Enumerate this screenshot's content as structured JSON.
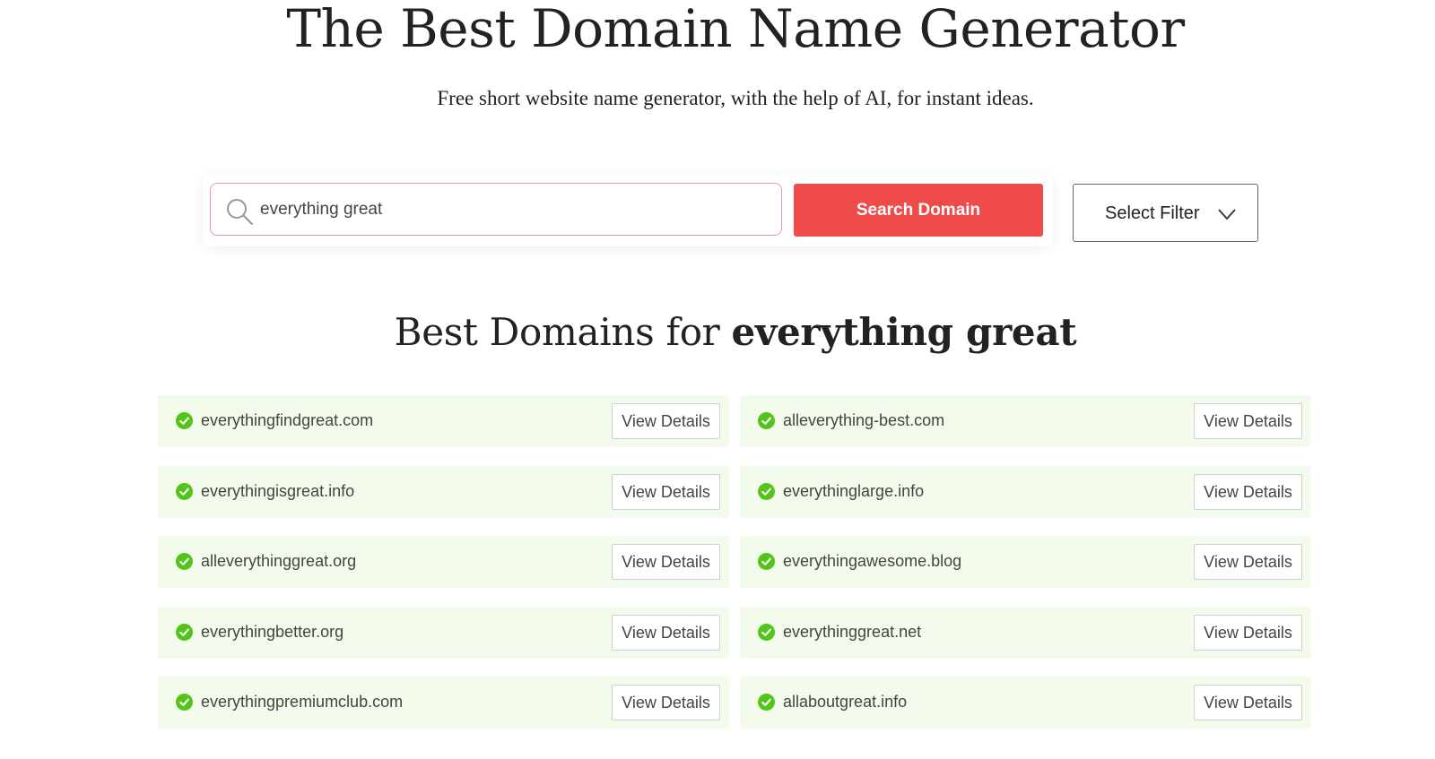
{
  "header": {
    "title": "The Best Domain Name Generator",
    "subtitle": "Free short website name generator, with the help of AI, for instant ideas."
  },
  "search": {
    "value": "everything great",
    "button_label": "Search Domain"
  },
  "filter": {
    "label": "Select Filter"
  },
  "results": {
    "heading_prefix": "Best Domains for ",
    "heading_query": "everything great",
    "details_label": "View Details",
    "available_color": "#52c41a",
    "items": [
      {
        "domain": "everythingfindgreat.com"
      },
      {
        "domain": "alleverything-best.com"
      },
      {
        "domain": "everythingisgreat.info"
      },
      {
        "domain": "everythinglarge.info"
      },
      {
        "domain": "alleverythinggreat.org"
      },
      {
        "domain": "everythingawesome.blog"
      },
      {
        "domain": "everythingbetter.org"
      },
      {
        "domain": "everythinggreat.net"
      },
      {
        "domain": "everythingpremiumclub.com"
      },
      {
        "domain": "allaboutgreat.info"
      }
    ]
  }
}
